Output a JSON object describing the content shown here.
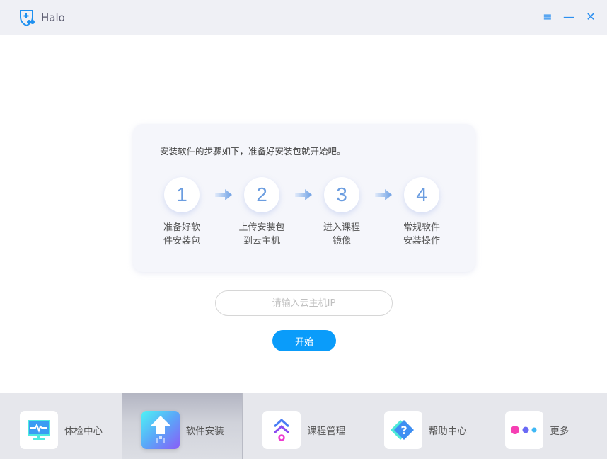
{
  "app": {
    "title": "Halo",
    "controls": {
      "menu": "≡",
      "minimize": "—",
      "close": "✕"
    }
  },
  "card": {
    "intro": "安装软件的步骤如下，准备好安装包就开始吧。",
    "steps": [
      {
        "number": "1",
        "line1": "准备好软",
        "line2": "件安装包"
      },
      {
        "number": "2",
        "line1": "上传安装包",
        "line2": "到云主机"
      },
      {
        "number": "3",
        "line1": "进入课程",
        "line2": "镜像"
      },
      {
        "number": "4",
        "line1": "常规软件",
        "line2": "安装操作"
      }
    ]
  },
  "form": {
    "ip_placeholder": "请输入云主机IP",
    "ip_value": "",
    "start_label": "开始"
  },
  "nav": {
    "active": 1,
    "items": [
      {
        "label": "体检中心",
        "icon": "monitor-heartbeat-icon"
      },
      {
        "label": "软件安装",
        "icon": "upload-arrow-icon"
      },
      {
        "label": "课程管理",
        "icon": "double-chevron-up-icon"
      },
      {
        "label": "帮助中心",
        "icon": "question-diamond-icon"
      },
      {
        "label": "更多",
        "icon": "dots-icon"
      }
    ]
  },
  "colors": {
    "accent": "#0a9cfa",
    "titlebar": "#eff0f5",
    "bottombar": "#e6e7ec"
  }
}
